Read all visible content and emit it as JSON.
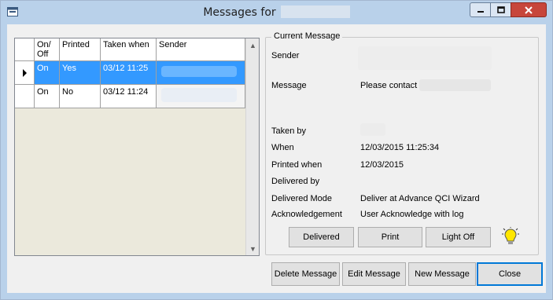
{
  "window": {
    "title": "Messages for",
    "controls": {
      "minimize": "minimize",
      "maximize": "maximize",
      "close": "close"
    }
  },
  "grid": {
    "columns": [
      "On/\nOff",
      "Printed",
      "Taken when",
      "Sender"
    ],
    "rows": [
      {
        "on_off": "On",
        "printed": "Yes",
        "taken_when": "03/12 11:25",
        "selected": true
      },
      {
        "on_off": "On",
        "printed": "No",
        "taken_when": "03/12 11:24",
        "selected": false
      }
    ]
  },
  "current_message": {
    "legend": "Current Message",
    "fields": [
      {
        "label": "Sender",
        "value": ""
      },
      {
        "label": "Message",
        "value": "Please contact"
      },
      {
        "label": "Taken by",
        "value": ""
      },
      {
        "label": "When",
        "value": "12/03/2015 11:25:34"
      },
      {
        "label": "Printed when",
        "value": "12/03/2015"
      },
      {
        "label": "Delivered by",
        "value": ""
      },
      {
        "label": "Delivered Mode",
        "value": "Deliver at Advance QCI Wizard"
      },
      {
        "label": "Acknowledgement",
        "value": "User Acknowledge with log"
      }
    ],
    "buttons": {
      "delivered": "Delivered",
      "print": "Print",
      "light_off": "Light Off"
    }
  },
  "footer": {
    "delete": "Delete Message",
    "edit": "Edit Message",
    "new": "New Message",
    "close": "Close"
  }
}
